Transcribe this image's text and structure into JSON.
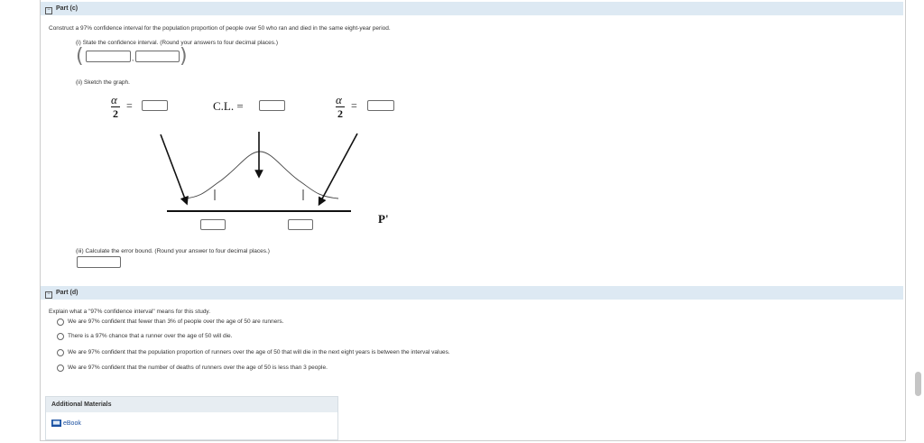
{
  "partC": {
    "toggle": "−",
    "label": "Part (c)",
    "question": "Construct a 97% confidence interval for the population proportion of people over 50 who ran and died in the same eight-year period.",
    "i_label": "(i) State the confidence interval. (Round your answers to four decimal places.)",
    "comma": ",",
    "ii_label": "(ii) Sketch the graph.",
    "alpha": "α",
    "two": "2",
    "eq": "=",
    "cl_label": "C.L. =",
    "p_prime": "P'",
    "iii_label": "(iii) Calculate the error bound. (Round your answer to four decimal places.)"
  },
  "partD": {
    "toggle": "−",
    "label": "Part (d)",
    "question": "Explain what a \"97% confidence interval\" means for this study.",
    "options": [
      "We are 97% confident that fewer than 3% of people over the age of 50 are runners.",
      "There is a 97% chance that a runner over the age of 50 will die.",
      "We are 97% confident that the population proportion of runners over the age of 50 that will die in the next eight years is between the interval values.",
      "We are 97% confident that the number of deaths of runners over the age of 50 is less than 3 people."
    ]
  },
  "additional": {
    "title": "Additional Materials",
    "ebook": "eBook"
  }
}
